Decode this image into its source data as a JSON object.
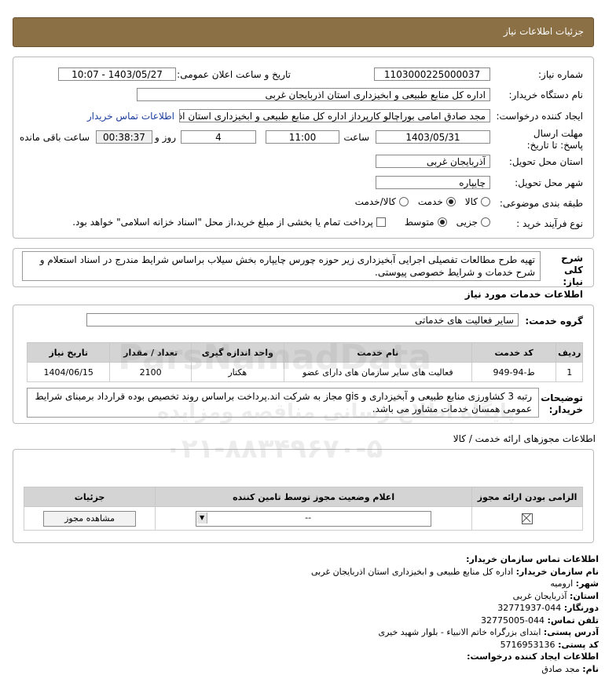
{
  "header": {
    "title": "جزئیات اطلاعات نیاز"
  },
  "form": {
    "need_number_label": "شماره نیاز:",
    "need_number": "1103000225000037",
    "announce_label": "تاریخ و ساعت اعلان عمومی:",
    "announce_value": "1403/05/27 - 10:07",
    "buyer_label": "نام دستگاه خریدار:",
    "buyer_value": "اداره کل منابع طبیعی و ابخیزداری استان اذربایجان غربی",
    "creator_label": "ایجاد کننده درخواست:",
    "creator_value": "مجد صادق امامی بوراچالو کارپرداز اداره کل منابع طبیعی و ابخیزداری استان اذربا",
    "contact_link": "اطلاعات تماس خریدار",
    "deadline_label": "مهلت ارسال پاسخ: تا تاریخ:",
    "deadline_date": "1403/05/31",
    "time_label": "ساعت",
    "deadline_time": "11:00",
    "days_value": "4",
    "days_label": "روز و",
    "remaining_time": "00:38:37",
    "remaining_label": "ساعت باقی مانده",
    "province_label": "استان محل تحویل:",
    "province_value": "آذربایجان غربی",
    "city_label": "شهر محل تحویل:",
    "city_value": "چایپاره",
    "category_label": "طبقه بندی موضوعی:",
    "category_options": [
      "کالا",
      "خدمت",
      "کالا/خدمت"
    ],
    "category_selected": "خدمت",
    "process_label": "نوع فرآیند خرید :",
    "process_options": [
      "جزیی",
      "متوسط"
    ],
    "process_selected": "متوسط",
    "payment_note": "پرداخت تمام یا بخشی از مبلغ خرید،از محل \"اسناد خزانه اسلامی\" خواهد بود."
  },
  "description": {
    "label": "شرح کلی نیاز:",
    "text": "تهیه طرح مطالعات تفصیلی اجرایی آبخیزداری زیر حوزه چورس چایپاره بخش سیلاب براساس شرایط مندرج در اسناد استعلام و شرح خدمات و شرایط خصوصی پیوستی."
  },
  "services": {
    "section_title": "اطلاعات خدمات مورد نیاز",
    "group_label": "گروه خدمت:",
    "group_value": "سایر فعالیت های خدماتی",
    "columns": [
      "ردیف",
      "کد خدمت",
      "نام خدمت",
      "واحد اندازه گیری",
      "تعداد / مقدار",
      "تاریخ نیاز"
    ],
    "rows": [
      {
        "row": "1",
        "code": "ط-94-949",
        "name": "فعالیت های سایر سازمان های دارای عضو",
        "unit": "هکتار",
        "qty": "2100",
        "date": "1404/06/15"
      }
    ]
  },
  "buyer_notes": {
    "label": "توضیحات خریدار:",
    "text": "رتبه 3 کشاورزی منابع طبیعی و آبخیزداری و gis مجاز به شرکت اند.پرداخت براساس روند تخصیص بوده قرارداد برمبنای شرایط عمومی همسان خدمات مشاور می باشد."
  },
  "permits": {
    "title": "اطلاعات مجوزهای ارائه خدمت / کالا",
    "columns": [
      "الزامی بودن ارائه مجوز",
      "اعلام وضعیت مجوز توسط تامین کننده",
      "جزئیات"
    ],
    "select_value": "--",
    "view_button": "مشاهده مجوز"
  },
  "contact": {
    "title": "اطلاعات تماس سازمان خریدار:",
    "org_label": "نام سازمان خریدار:",
    "org_value": "اداره کل منابع طبیعی و ابخیزداری استان اذربایجان غربی",
    "city_label": "شهر:",
    "city_value": "ارومیه",
    "province_label": "استان:",
    "province_value": "آذربایجان غربی",
    "fax_label": "دورنگار:",
    "fax_value": "044-32771937",
    "phone_label": "تلفن تماس:",
    "phone_value": "044-32775005",
    "address_label": "آدرس پستی:",
    "address_value": "ابتدای بزرگراه خاتم الانبیاء - بلوار شهید خیری",
    "postal_label": "کد پستی:",
    "postal_value": "5716953136",
    "creator_title": "اطلاعات ایجاد کننده درخواست:",
    "name_label": "نام:",
    "name_value": "مجد صادق"
  },
  "watermark": {
    "brand": "ParsNamadData",
    "tagline": "پایگاه اطلاع رسانی مناقصه ومزایده",
    "phone": "۰۲۱-۸۸۳۴۹۶۷۰-۵"
  }
}
